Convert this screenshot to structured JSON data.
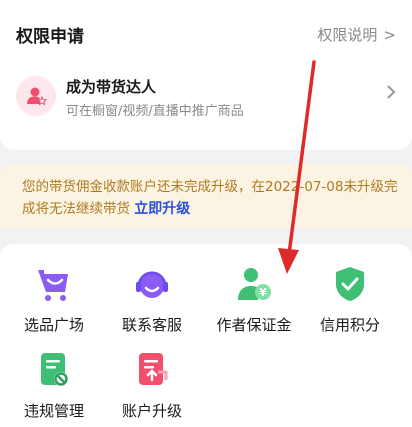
{
  "header": {
    "title": "权限申请",
    "explain_label": "权限说明",
    "chevron": ">"
  },
  "talent": {
    "title": "成为带货达人",
    "subtitle": "可在橱窗/视频/直播中推广商品",
    "icon": "user-star-icon"
  },
  "notice": {
    "text": "您的带货佣金收款账户还未完成升级，在2022-07-08未升级完成将无法继续带货",
    "link_label": "立即升级",
    "text_color": "#b07a22",
    "link_color": "#2a4fd9"
  },
  "grid": {
    "items": [
      {
        "label": "选品广场",
        "icon": "cart-icon"
      },
      {
        "label": "联系客服",
        "icon": "headset-icon"
      },
      {
        "label": "作者保证金",
        "icon": "user-yuan-icon"
      },
      {
        "label": "信用积分",
        "icon": "shield-check-icon"
      },
      {
        "label": "违规管理",
        "icon": "doc-ban-icon"
      },
      {
        "label": "账户升级",
        "icon": "doc-upgrade-icon"
      }
    ]
  },
  "annotation": {
    "color": "#e0292b"
  }
}
